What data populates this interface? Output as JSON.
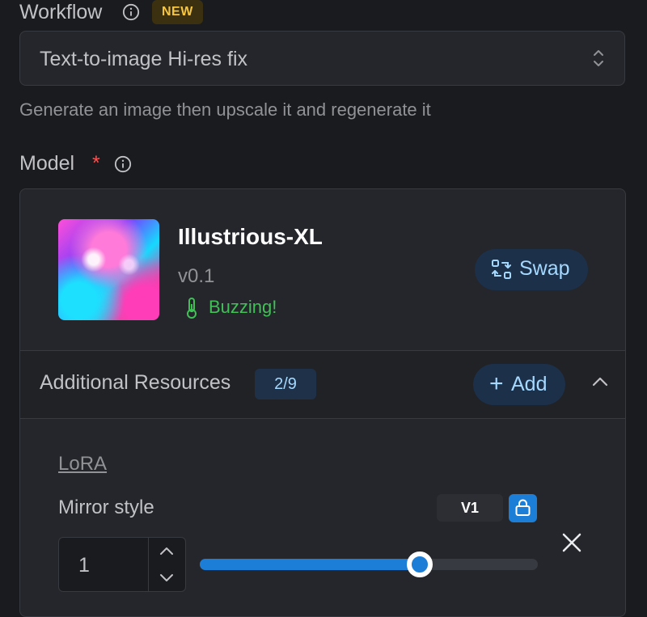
{
  "workflow": {
    "label": "Workflow",
    "badge": "NEW",
    "selected": "Text-to-image Hi-res fix",
    "description": "Generate an image then upscale it and regenerate it"
  },
  "model": {
    "label": "Model",
    "required_mark": "*",
    "name": "Illustrious-XL",
    "version": "v0.1",
    "status": "Buzzing!",
    "swap_label": "Swap"
  },
  "additional_resources": {
    "label": "Additional Resources",
    "count": "2/9",
    "add_label": "Add",
    "add_symbol": "+",
    "category_link": "LoRA",
    "items": [
      {
        "name": "Mirror style",
        "version": "V1",
        "strength_value": "1",
        "strength_fraction": 0.65
      }
    ]
  },
  "colors": {
    "accent": "#1c7ed6",
    "buzz_green": "#40c057",
    "new_badge": "#f5c542",
    "required": "#fa5252"
  },
  "icons": {
    "info": "info-icon",
    "select": "chevron-up-down-icon",
    "status": "thermometer-icon",
    "swap": "swap-arrows-icon",
    "collapse": "chevron-up-icon",
    "lock": "lock-icon",
    "remove": "close-icon"
  }
}
